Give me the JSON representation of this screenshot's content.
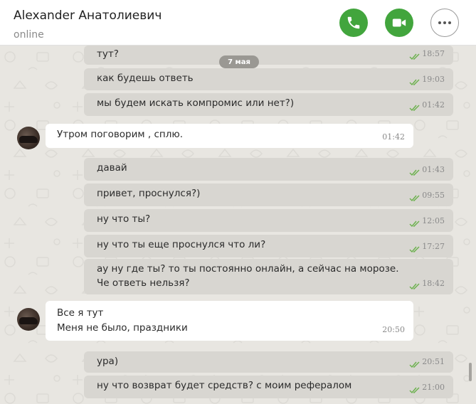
{
  "header": {
    "contact_name": "Alexander Анатолиевич",
    "status": "online",
    "call_icon": "phone-icon",
    "video_icon": "video-camera-icon",
    "more_icon": "more-horizontal-icon"
  },
  "colors": {
    "accent": "#42a53d",
    "chat_bg": "#e8e6e1",
    "outgoing_bubble": "#d8d6d1",
    "incoming_bubble": "#ffffff",
    "ticks": "#6ab04c"
  },
  "chat": {
    "date_separator": "7 мая",
    "messages": [
      {
        "dir": "out",
        "lines": [
          "тут?"
        ],
        "time": "18:57",
        "read": true
      },
      {
        "dir": "out",
        "lines": [
          "как будешь ответь"
        ],
        "time": "19:03",
        "read": true
      },
      {
        "dir": "out",
        "lines": [
          "мы будем искать компромис или нет?)"
        ],
        "time": "01:42",
        "read": true
      },
      {
        "dir": "in",
        "lines": [
          "Утром поговорим , сплю."
        ],
        "time": "01:42"
      },
      {
        "dir": "out",
        "lines": [
          "давай"
        ],
        "time": "01:43",
        "read": true
      },
      {
        "dir": "out",
        "lines": [
          "привет, проснулся?)"
        ],
        "time": "09:55",
        "read": true
      },
      {
        "dir": "out",
        "lines": [
          "ну что ты?"
        ],
        "time": "12:05",
        "read": true
      },
      {
        "dir": "out",
        "lines": [
          "ну что ты еще проснулся что ли?"
        ],
        "time": "17:27",
        "read": true
      },
      {
        "dir": "out",
        "lines": [
          "ау ну где ты? то ты постоянно онлайн, а сейчас на морозе.",
          "Че ответь нельзя?"
        ],
        "time": "18:42",
        "read": true
      },
      {
        "dir": "in",
        "lines": [
          "Все я тут",
          "Меня не было, праздники"
        ],
        "time": "20:50"
      },
      {
        "dir": "out",
        "lines": [
          "ура)"
        ],
        "time": "20:51",
        "read": true
      },
      {
        "dir": "out",
        "lines": [
          "ну что возврат будет средств? с моим рефералом"
        ],
        "time": "21:00",
        "read": true
      }
    ]
  }
}
